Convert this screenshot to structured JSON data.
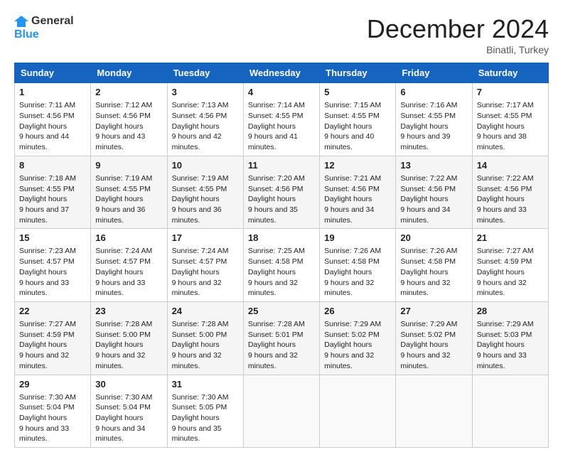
{
  "header": {
    "logo_general": "General",
    "logo_blue": "Blue",
    "month": "December 2024",
    "location": "Binatli, Turkey"
  },
  "weekdays": [
    "Sunday",
    "Monday",
    "Tuesday",
    "Wednesday",
    "Thursday",
    "Friday",
    "Saturday"
  ],
  "weeks": [
    [
      {
        "day": "1",
        "sunrise": "7:11 AM",
        "sunset": "4:56 PM",
        "daylight": "9 hours and 44 minutes."
      },
      {
        "day": "2",
        "sunrise": "7:12 AM",
        "sunset": "4:56 PM",
        "daylight": "9 hours and 43 minutes."
      },
      {
        "day": "3",
        "sunrise": "7:13 AM",
        "sunset": "4:56 PM",
        "daylight": "9 hours and 42 minutes."
      },
      {
        "day": "4",
        "sunrise": "7:14 AM",
        "sunset": "4:55 PM",
        "daylight": "9 hours and 41 minutes."
      },
      {
        "day": "5",
        "sunrise": "7:15 AM",
        "sunset": "4:55 PM",
        "daylight": "9 hours and 40 minutes."
      },
      {
        "day": "6",
        "sunrise": "7:16 AM",
        "sunset": "4:55 PM",
        "daylight": "9 hours and 39 minutes."
      },
      {
        "day": "7",
        "sunrise": "7:17 AM",
        "sunset": "4:55 PM",
        "daylight": "9 hours and 38 minutes."
      }
    ],
    [
      {
        "day": "8",
        "sunrise": "7:18 AM",
        "sunset": "4:55 PM",
        "daylight": "9 hours and 37 minutes."
      },
      {
        "day": "9",
        "sunrise": "7:19 AM",
        "sunset": "4:55 PM",
        "daylight": "9 hours and 36 minutes."
      },
      {
        "day": "10",
        "sunrise": "7:19 AM",
        "sunset": "4:55 PM",
        "daylight": "9 hours and 36 minutes."
      },
      {
        "day": "11",
        "sunrise": "7:20 AM",
        "sunset": "4:56 PM",
        "daylight": "9 hours and 35 minutes."
      },
      {
        "day": "12",
        "sunrise": "7:21 AM",
        "sunset": "4:56 PM",
        "daylight": "9 hours and 34 minutes."
      },
      {
        "day": "13",
        "sunrise": "7:22 AM",
        "sunset": "4:56 PM",
        "daylight": "9 hours and 34 minutes."
      },
      {
        "day": "14",
        "sunrise": "7:22 AM",
        "sunset": "4:56 PM",
        "daylight": "9 hours and 33 minutes."
      }
    ],
    [
      {
        "day": "15",
        "sunrise": "7:23 AM",
        "sunset": "4:57 PM",
        "daylight": "9 hours and 33 minutes."
      },
      {
        "day": "16",
        "sunrise": "7:24 AM",
        "sunset": "4:57 PM",
        "daylight": "9 hours and 33 minutes."
      },
      {
        "day": "17",
        "sunrise": "7:24 AM",
        "sunset": "4:57 PM",
        "daylight": "9 hours and 32 minutes."
      },
      {
        "day": "18",
        "sunrise": "7:25 AM",
        "sunset": "4:58 PM",
        "daylight": "9 hours and 32 minutes."
      },
      {
        "day": "19",
        "sunrise": "7:26 AM",
        "sunset": "4:58 PM",
        "daylight": "9 hours and 32 minutes."
      },
      {
        "day": "20",
        "sunrise": "7:26 AM",
        "sunset": "4:58 PM",
        "daylight": "9 hours and 32 minutes."
      },
      {
        "day": "21",
        "sunrise": "7:27 AM",
        "sunset": "4:59 PM",
        "daylight": "9 hours and 32 minutes."
      }
    ],
    [
      {
        "day": "22",
        "sunrise": "7:27 AM",
        "sunset": "4:59 PM",
        "daylight": "9 hours and 32 minutes."
      },
      {
        "day": "23",
        "sunrise": "7:28 AM",
        "sunset": "5:00 PM",
        "daylight": "9 hours and 32 minutes."
      },
      {
        "day": "24",
        "sunrise": "7:28 AM",
        "sunset": "5:00 PM",
        "daylight": "9 hours and 32 minutes."
      },
      {
        "day": "25",
        "sunrise": "7:28 AM",
        "sunset": "5:01 PM",
        "daylight": "9 hours and 32 minutes."
      },
      {
        "day": "26",
        "sunrise": "7:29 AM",
        "sunset": "5:02 PM",
        "daylight": "9 hours and 32 minutes."
      },
      {
        "day": "27",
        "sunrise": "7:29 AM",
        "sunset": "5:02 PM",
        "daylight": "9 hours and 32 minutes."
      },
      {
        "day": "28",
        "sunrise": "7:29 AM",
        "sunset": "5:03 PM",
        "daylight": "9 hours and 33 minutes."
      }
    ],
    [
      {
        "day": "29",
        "sunrise": "7:30 AM",
        "sunset": "5:04 PM",
        "daylight": "9 hours and 33 minutes."
      },
      {
        "day": "30",
        "sunrise": "7:30 AM",
        "sunset": "5:04 PM",
        "daylight": "9 hours and 34 minutes."
      },
      {
        "day": "31",
        "sunrise": "7:30 AM",
        "sunset": "5:05 PM",
        "daylight": "9 hours and 35 minutes."
      },
      null,
      null,
      null,
      null
    ]
  ],
  "labels": {
    "sunrise": "Sunrise:",
    "sunset": "Sunset:",
    "daylight": "Daylight hours"
  }
}
